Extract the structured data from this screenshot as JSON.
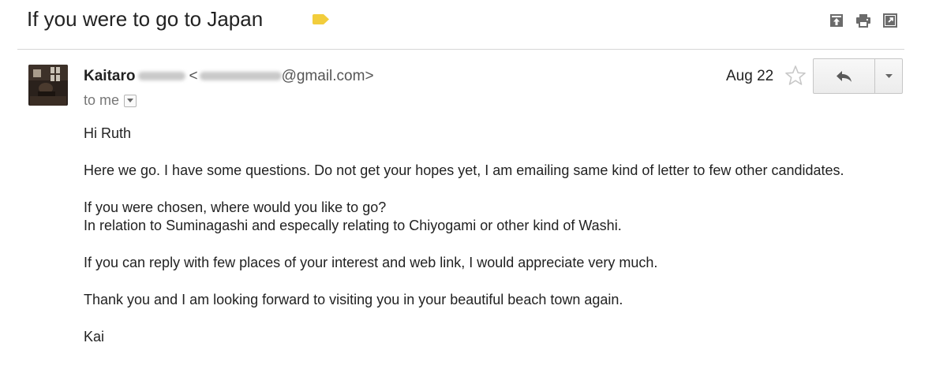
{
  "email": {
    "subject": "If you were to go to Japan",
    "label_color": "#f2cd3c",
    "sender": {
      "name_visible": "Kaitaro",
      "email_suffix": "@gmail.com>",
      "email_prefix_visible": "<"
    },
    "to_line": "to me",
    "date": "Aug 22",
    "body": {
      "greeting": "Hi Ruth",
      "para1": "Here we go.  I have some questions.  Do not get your hopes yet, I am emailing same kind of letter to few other candidates.",
      "para2_line1": "If you were chosen, where would you like to go?",
      "para2_line2": "In relation to Suminagashi and especally relating to Chiyogami or other kind of Washi.",
      "para3": "If you can reply with few places of your interest and web link, I would appreciate very much.",
      "para4": "Thank you and I am looking forward to visiting you in your beautiful beach town again.",
      "signoff": "Kai"
    }
  },
  "icons": {
    "archive": "archive-icon",
    "print": "print-icon",
    "new_window": "new-window-icon",
    "star": "star-icon",
    "reply": "reply-icon",
    "more": "chevron-down-icon",
    "label": "label-tag-icon"
  }
}
